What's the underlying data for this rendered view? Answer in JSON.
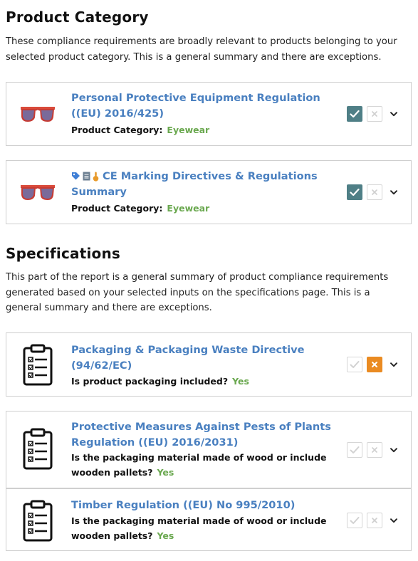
{
  "product_category": {
    "title": "Product Category",
    "description": "These compliance requirements are broadly relevant to products belonging to your selected product category. This is a general summary and there are exceptions.",
    "items": [
      {
        "title": "Personal Protective Equipment Regulation ((EU) 2016/425)",
        "meta_label": "Product Category:",
        "meta_value": "Eyewear",
        "thumbnail": "sunglasses-icon",
        "title_icons": [],
        "status": "check"
      },
      {
        "title": "CE Marking Directives & Regulations Summary",
        "meta_label": "Product Category:",
        "meta_value": "Eyewear",
        "thumbnail": "sunglasses-icon",
        "title_icons": [
          "tag-icon",
          "document-icon",
          "hand-icon"
        ],
        "status": "check"
      }
    ]
  },
  "specifications": {
    "title": "Specifications",
    "description": "This part of the report is a general summary of product compliance requirements generated based on your selected inputs on the specifications page. This is a general summary and there are exceptions.",
    "items": [
      {
        "title": "Packaging & Packaging Waste Directive (94/62/EC)",
        "meta_label": "Is product packaging included?",
        "meta_value": "Yes",
        "thumbnail": "checklist-clipboard-icon",
        "status": "x"
      },
      {
        "title": "Protective Measures Against Pests of Plants Regulation ((EU) 2016/2031)",
        "meta_label": "Is the packaging material made of wood or include wooden pallets?",
        "meta_value": "Yes",
        "thumbnail": "checklist-clipboard-icon",
        "status": "none"
      },
      {
        "title": "Timber Regulation ((EU) No 995/2010)",
        "meta_label": "Is the packaging material made of wood or include wooden pallets?",
        "meta_value": "Yes",
        "thumbnail": "checklist-clipboard-icon",
        "status": "none"
      }
    ]
  },
  "colors": {
    "link_blue": "#4a80c0",
    "value_green": "#6aa84f",
    "check_active": "#4f7f86",
    "x_active": "#ea8b22"
  }
}
